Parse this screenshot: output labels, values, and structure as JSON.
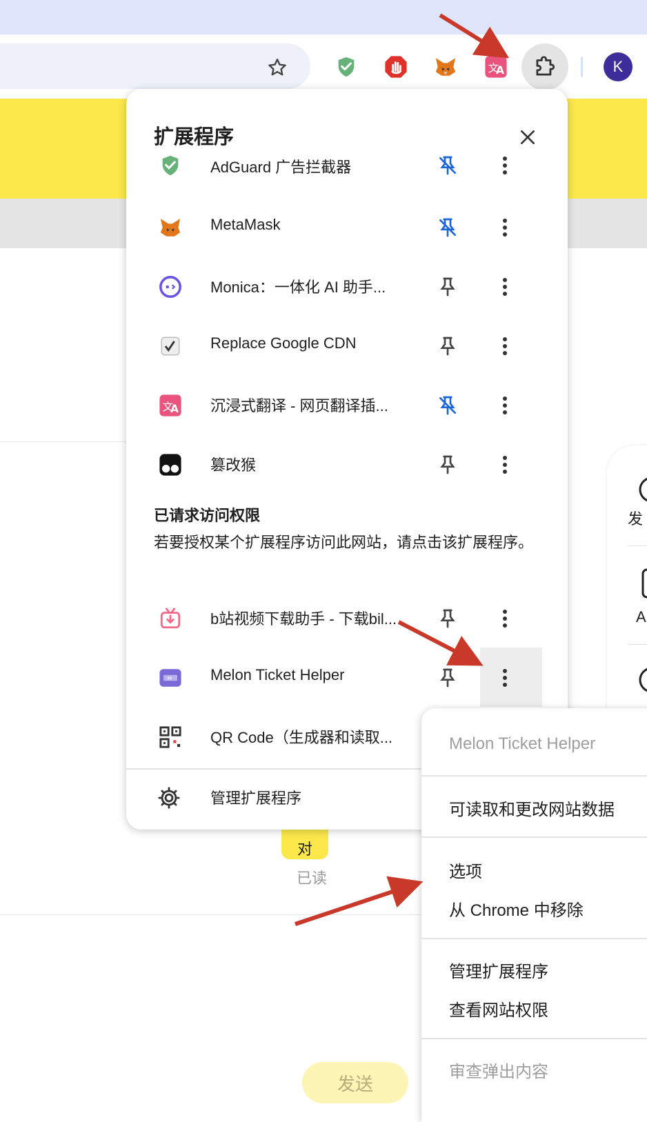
{
  "browser": {
    "avatar_letter": "K",
    "icons": [
      "star-icon",
      "adguard-shield-icon",
      "adblock-hand-icon",
      "metamask-fox-icon",
      "immersive-translate-icon",
      "puzzle-extensions-icon"
    ],
    "accent": "#3c2d9a"
  },
  "page": {
    "right_card_label_1": "发",
    "right_card_label_2": "A",
    "bubble_text": "对",
    "read_label": "已读",
    "send_label": "发送",
    "yellow": "#fce84b"
  },
  "popup": {
    "title": "扩展程序",
    "items": [
      {
        "name": "AdGuard 广告拦截器",
        "icon": "adguard-shield-icon",
        "pinned": true
      },
      {
        "name": "MetaMask",
        "icon": "metamask-fox-icon",
        "pinned": true
      },
      {
        "name": "Monica：一体化 AI 助手...",
        "icon": "monica-icon",
        "pinned": false
      },
      {
        "name": "Replace Google CDN",
        "icon": "replace-cdn-icon",
        "pinned": false
      },
      {
        "name": "沉浸式翻译 - 网页翻译插...",
        "icon": "immersive-translate-icon",
        "pinned": true
      },
      {
        "name": "篡改猴",
        "icon": "tampermonkey-icon",
        "pinned": false
      }
    ],
    "requested_section": {
      "header": "已请求访问权限",
      "description": "若要授权某个扩展程序访问此网站，请点击该扩展程序。",
      "items": [
        {
          "name": "b站视频下载助手 - 下载bil...",
          "icon": "bilibili-download-icon",
          "pinned": false
        },
        {
          "name": "Melon Ticket Helper",
          "icon": "melon-ticket-icon",
          "pinned": false
        },
        {
          "name": "QR Code（生成器和读取...",
          "icon": "qr-code-icon",
          "pinned": false
        }
      ]
    },
    "manage_label": "管理扩展程序",
    "pinned_color": "#1a66d9"
  },
  "context_menu": {
    "header": "Melon Ticket Helper",
    "site_data": "可读取和更改网站数据",
    "options": "选项",
    "remove": "从 Chrome 中移除",
    "manage": "管理扩展程序",
    "view_permissions": "查看网站权限",
    "inspect_popup": "审查弹出内容"
  },
  "annotation_color": "#c8392a"
}
